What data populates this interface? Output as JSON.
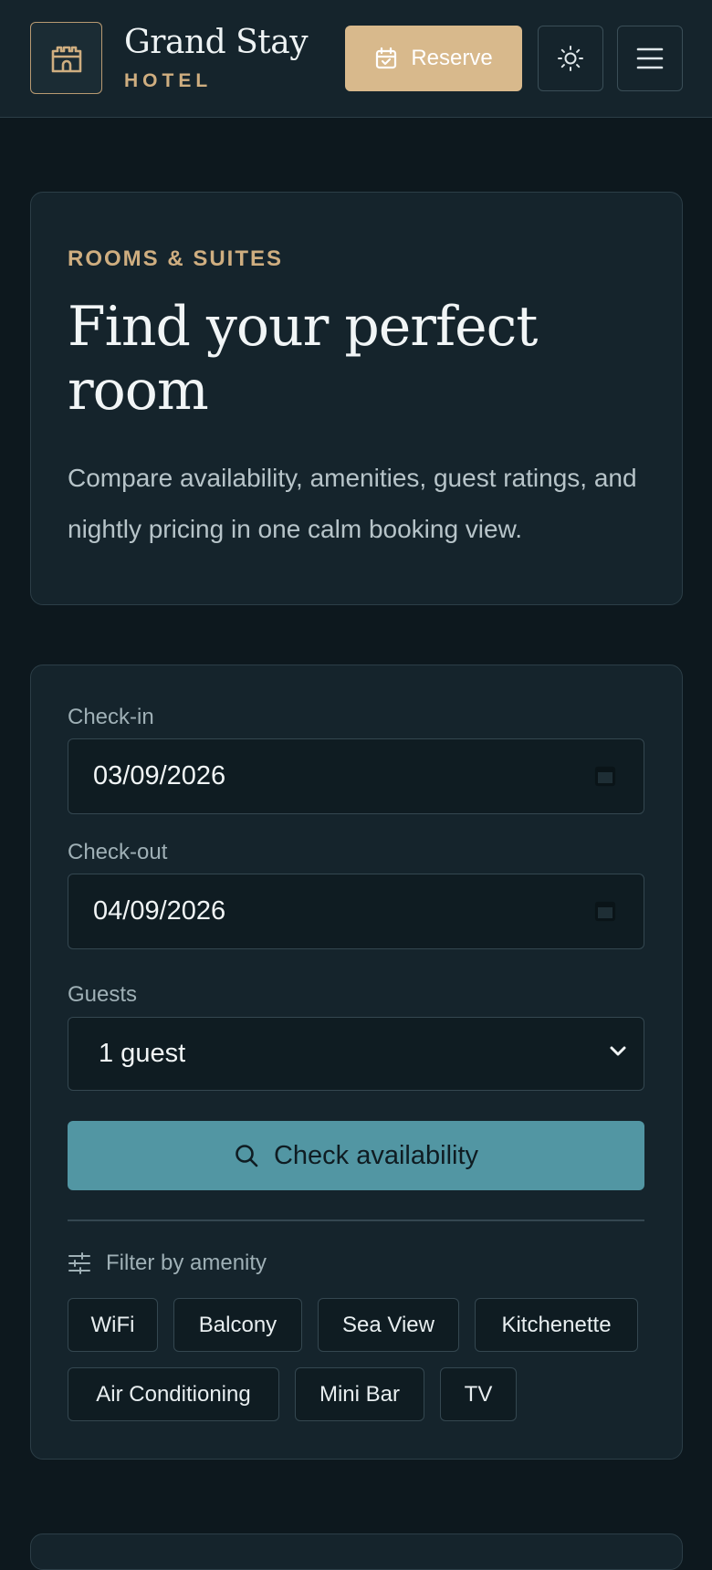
{
  "header": {
    "brand_name": "Grand Stay",
    "brand_sub": "HOTEL",
    "reserve_label": "Reserve",
    "logo_icon": "castle-icon",
    "theme_icon": "sun-icon",
    "menu_icon": "hamburger-icon"
  },
  "hero": {
    "eyebrow": "ROOMS & SUITES",
    "title": "Find your perfect room",
    "description": "Compare availability, amenities, guest ratings, and nightly pricing in one calm booking view."
  },
  "search": {
    "checkin_label": "Check-in",
    "checkin_value": "03/09/2026",
    "checkout_label": "Check-out",
    "checkout_value": "04/09/2026",
    "guests_label": "Guests",
    "guests_value": "1 guest",
    "check_label": "Check availability",
    "filter_label": "Filter by amenity",
    "amenities": [
      "WiFi",
      "Balcony",
      "Sea View",
      "Kitchenette",
      "Air Conditioning",
      "Mini Bar",
      "TV"
    ]
  },
  "colors": {
    "background": "#0d181e",
    "surface": "#15242c",
    "accent_gold": "#d8b98c",
    "accent_teal": "#5296a3"
  }
}
